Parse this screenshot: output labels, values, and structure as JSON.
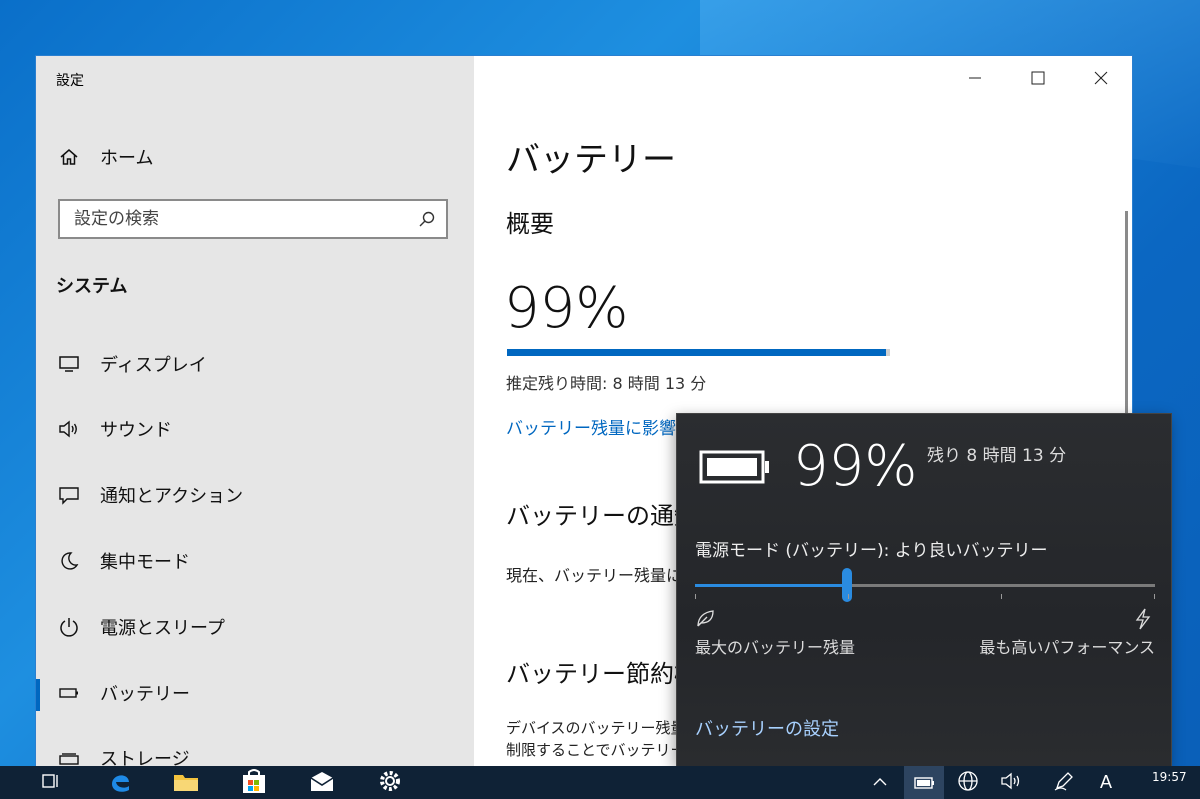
{
  "window": {
    "title": "設定",
    "controls": {
      "minimize": "minimize-icon",
      "maximize": "maximize-icon",
      "close": "close-icon"
    }
  },
  "sidebar": {
    "home_label": "ホーム",
    "search_placeholder": "設定の検索",
    "section_label": "システム",
    "items": [
      {
        "label": "ディスプレイ",
        "icon": "display-icon"
      },
      {
        "label": "サウンド",
        "icon": "speaker-icon"
      },
      {
        "label": "通知とアクション",
        "icon": "notification-icon"
      },
      {
        "label": "集中モード",
        "icon": "moon-icon"
      },
      {
        "label": "電源とスリープ",
        "icon": "power-icon"
      },
      {
        "label": "バッテリー",
        "icon": "battery-icon",
        "selected": true
      },
      {
        "label": "ストレージ",
        "icon": "storage-icon"
      }
    ]
  },
  "main": {
    "title": "バッテリー",
    "overview_heading": "概要",
    "battery_percent_text": "99%",
    "battery_level": 0.99,
    "estimated_remaining": "推定残り時間: 8 時間 13 分",
    "affect_link": "バッテリー残量に影響を",
    "notification_heading": "バッテリーの通知",
    "notification_text": "現在、バッテリー残量に",
    "saver_heading": "バッテリー節約機",
    "saver_text_line1": "デバイスのバッテリー残量",
    "saver_text_line2": "制限することでバッテリー"
  },
  "flyout": {
    "percent": "99%",
    "remaining": "残り 8 時間 13 分",
    "power_mode": "電源モード (バッテリー): より良いバッテリー",
    "slider_value": 0.33,
    "left_label": "最大のバッテリー残量",
    "right_label": "最も高いパフォーマンス",
    "settings_link": "バッテリーの設定"
  },
  "taskbar": {
    "icons": [
      "task-view-icon",
      "edge-icon",
      "file-explorer-icon",
      "store-icon",
      "mail-icon",
      "settings-icon"
    ],
    "tray_icons": [
      "chevron-up-icon",
      "battery-icon",
      "network-icon",
      "volume-icon",
      "pen-icon",
      "ime-icon"
    ],
    "ime_label": "A",
    "time": "19:57"
  },
  "colors": {
    "accent": "#0067c0",
    "flyout_bg": "#2b2d30",
    "flyout_accent": "#2a8be0",
    "link_dark": "#a8d1ff",
    "taskbar": "#0f2236"
  }
}
